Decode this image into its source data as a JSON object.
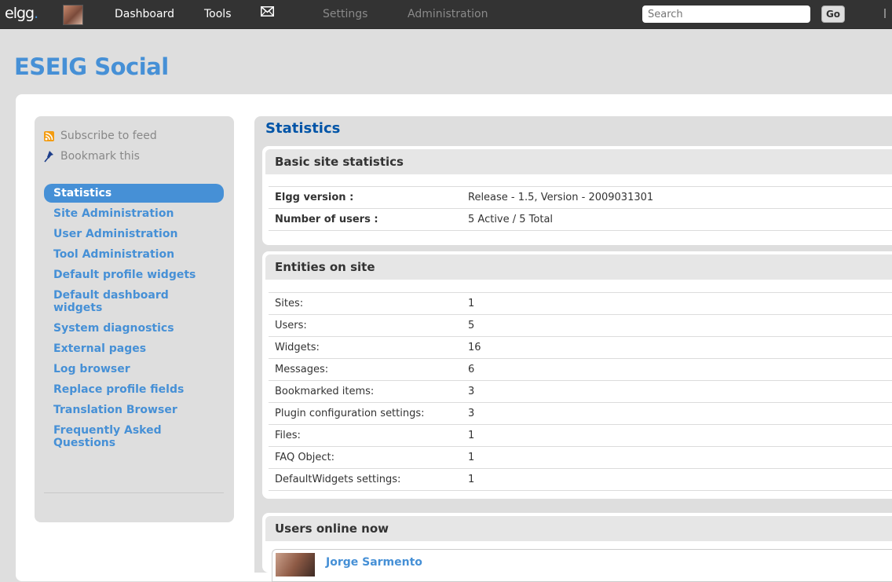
{
  "topbar": {
    "logo": "elgg",
    "logo_dot": ".",
    "nav": {
      "dashboard": "Dashboard",
      "tools": "Tools",
      "settings": "Settings",
      "administration": "Administration"
    },
    "search_placeholder": "Search",
    "go_label": "Go"
  },
  "site": {
    "title": "ESEIG Social"
  },
  "sidebar": {
    "subscribe": "Subscribe to feed",
    "bookmark": "Bookmark this",
    "menu": [
      "Statistics",
      "Site Administration",
      "User Administration",
      "Tool Administration",
      "Default profile widgets",
      "Default dashboard widgets",
      "System diagnostics",
      "External pages",
      "Log browser",
      "Replace profile fields",
      "Translation Browser",
      "Frequently Asked Questions"
    ]
  },
  "main": {
    "heading": "Statistics",
    "basic": {
      "title": "Basic site statistics",
      "rows": [
        {
          "label": "Elgg version :",
          "value": "Release - 1.5, Version - 2009031301"
        },
        {
          "label": "Number of users :",
          "value": "5 Active / 5 Total"
        }
      ]
    },
    "entities": {
      "title": "Entities on site",
      "rows": [
        {
          "label": "Sites:",
          "value": "1"
        },
        {
          "label": "Users:",
          "value": "5"
        },
        {
          "label": "Widgets:",
          "value": "16"
        },
        {
          "label": "Messages:",
          "value": "6"
        },
        {
          "label": "Bookmarked items:",
          "value": "3"
        },
        {
          "label": "Plugin configuration settings:",
          "value": "3"
        },
        {
          "label": "Files:",
          "value": "1"
        },
        {
          "label": "FAQ Object:",
          "value": "1"
        },
        {
          "label": "DefaultWidgets settings:",
          "value": "1"
        }
      ]
    },
    "online": {
      "title": "Users online now",
      "users": [
        {
          "name": "Jorge Sarmento"
        }
      ]
    }
  },
  "colors": {
    "topbar": "#333333",
    "accent": "#4690d6",
    "heading": "#0054a7",
    "panel_bg": "#dedede"
  }
}
